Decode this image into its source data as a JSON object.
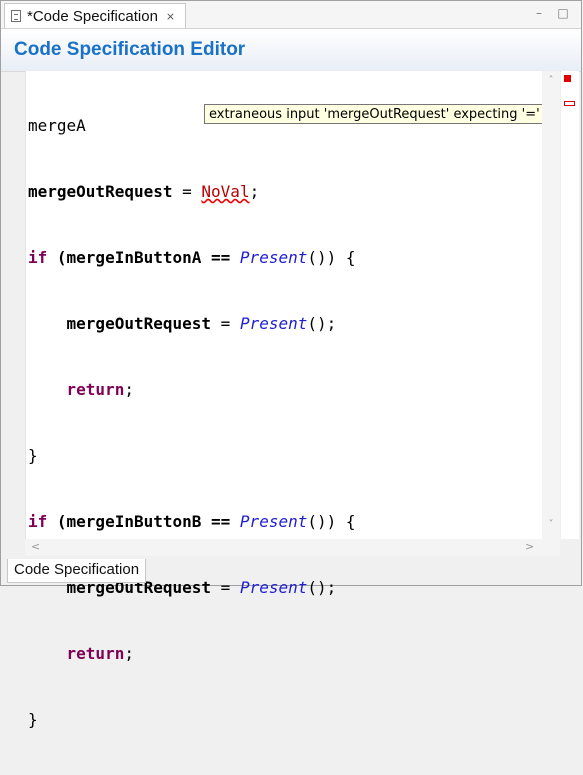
{
  "tab": {
    "title": "*Code Specification",
    "close_icon": "⨯",
    "icon": "file-icon"
  },
  "window_controls": {
    "minimize": "–",
    "maximize": "□"
  },
  "header": {
    "title": "Code Specification Editor"
  },
  "code": {
    "line1": "mergeA",
    "line2_var": "mergeOutRequest",
    "line2_eq": " = ",
    "line2_err": "NoVal",
    "line2_end": ";",
    "kw_if": "if",
    "line3_a": " (mergeInButtonA == ",
    "present": "Present",
    "paren_close": "()) {",
    "indent_var": "    mergeOutRequest",
    "assign": " = ",
    "call_end": "();",
    "kw_return": "return",
    "semicolon": ";",
    "brace": "}",
    "line7_a": " (mergeInButtonB == "
  },
  "tooltip": {
    "text": "extraneous input 'mergeOutRequest' expecting '='"
  },
  "scroll": {
    "up": "˄",
    "down": "˅",
    "left": "<",
    "right": ">"
  },
  "bottom_tab": {
    "label": "Code Specification"
  },
  "colors": {
    "header_title": "#1a71c8",
    "keyword": "#7f0055",
    "method": "#1d1dd2",
    "error": "#e00000"
  }
}
